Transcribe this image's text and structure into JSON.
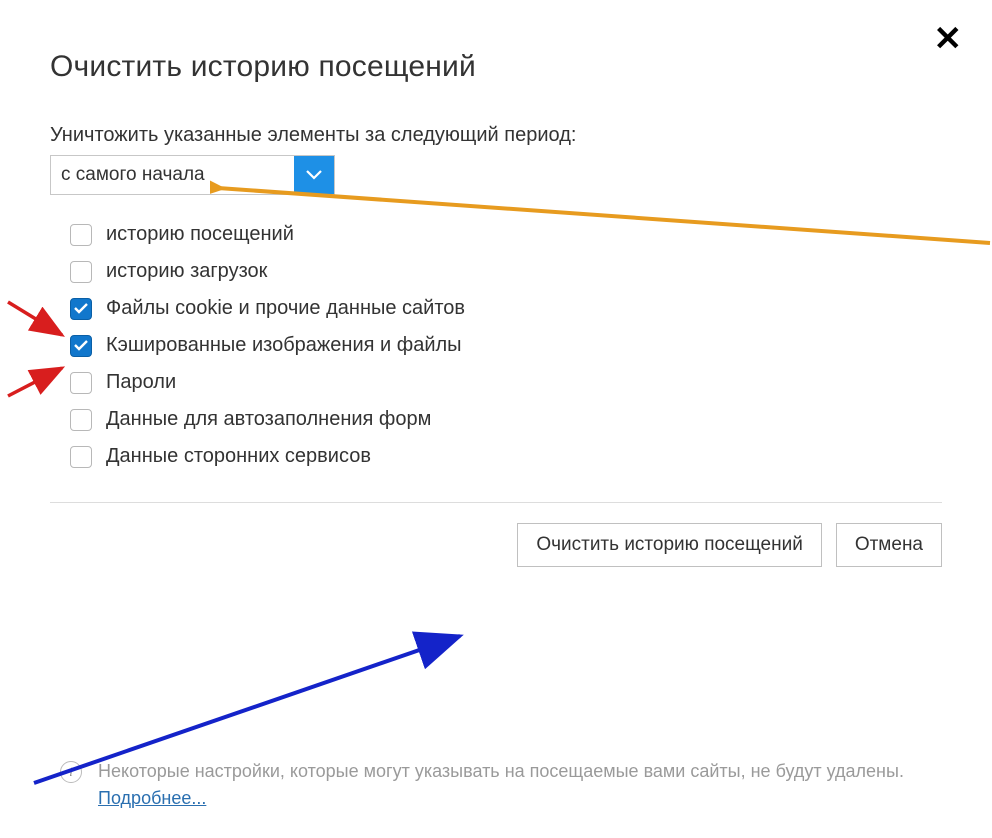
{
  "title": "Очистить историю посещений",
  "period_label": "Уничтожить указанные элементы за следующий период:",
  "period_value": "с самого начала",
  "options": [
    {
      "label": "историю посещений",
      "checked": false
    },
    {
      "label": "историю загрузок",
      "checked": false
    },
    {
      "label": "Файлы cookie и прочие данные сайтов",
      "checked": true
    },
    {
      "label": "Кэшированные изображения и файлы",
      "checked": true
    },
    {
      "label": "Пароли",
      "checked": false
    },
    {
      "label": "Данные для автозаполнения форм",
      "checked": false
    },
    {
      "label": "Данные сторонних сервисов",
      "checked": false
    }
  ],
  "clear_button": "Очистить историю посещений",
  "cancel_button": "Отмена",
  "footer_text": "Некоторые настройки, которые могут указывать на посещаемые вами сайты, не будут удалены. ",
  "footer_link": "Подробнее..."
}
